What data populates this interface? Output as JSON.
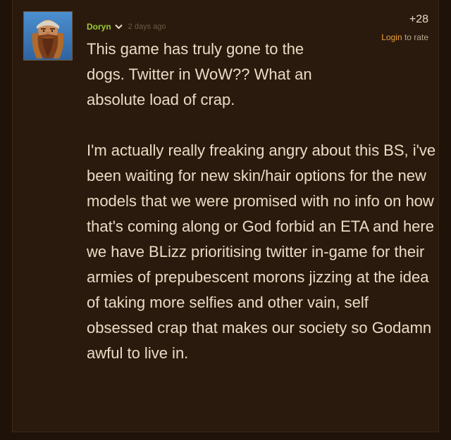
{
  "post": {
    "author": "Doryn",
    "time": "2 days ago",
    "score": "+28",
    "rate": {
      "login_label": "Login",
      "suffix": "to rate"
    },
    "paragraphs": [
      "This game has truly gone to the dogs. Twitter in WoW?? What an absolute load of crap.",
      "I'm actually really freaking angry about this BS, i've been waiting for new skin/hair options for the new models that we were promised with no info on how that's coming along or God forbid an ETA and here we have BLizz prioritising twitter in-game for their armies of prepubescent morons jizzing at the idea of taking more selfies and other vain, self obsessed crap that makes our society so Godamn awful to live in."
    ]
  },
  "icons": {
    "author_menu": "chevron-down-icon",
    "avatar": "dwarf-avatar"
  },
  "colors": {
    "background": "#1e1209",
    "panel": "#2a1a0d",
    "text": "#e9dcc5",
    "author": "#9acd32",
    "login_link": "#f2a13a",
    "muted": "#6b5a46"
  }
}
